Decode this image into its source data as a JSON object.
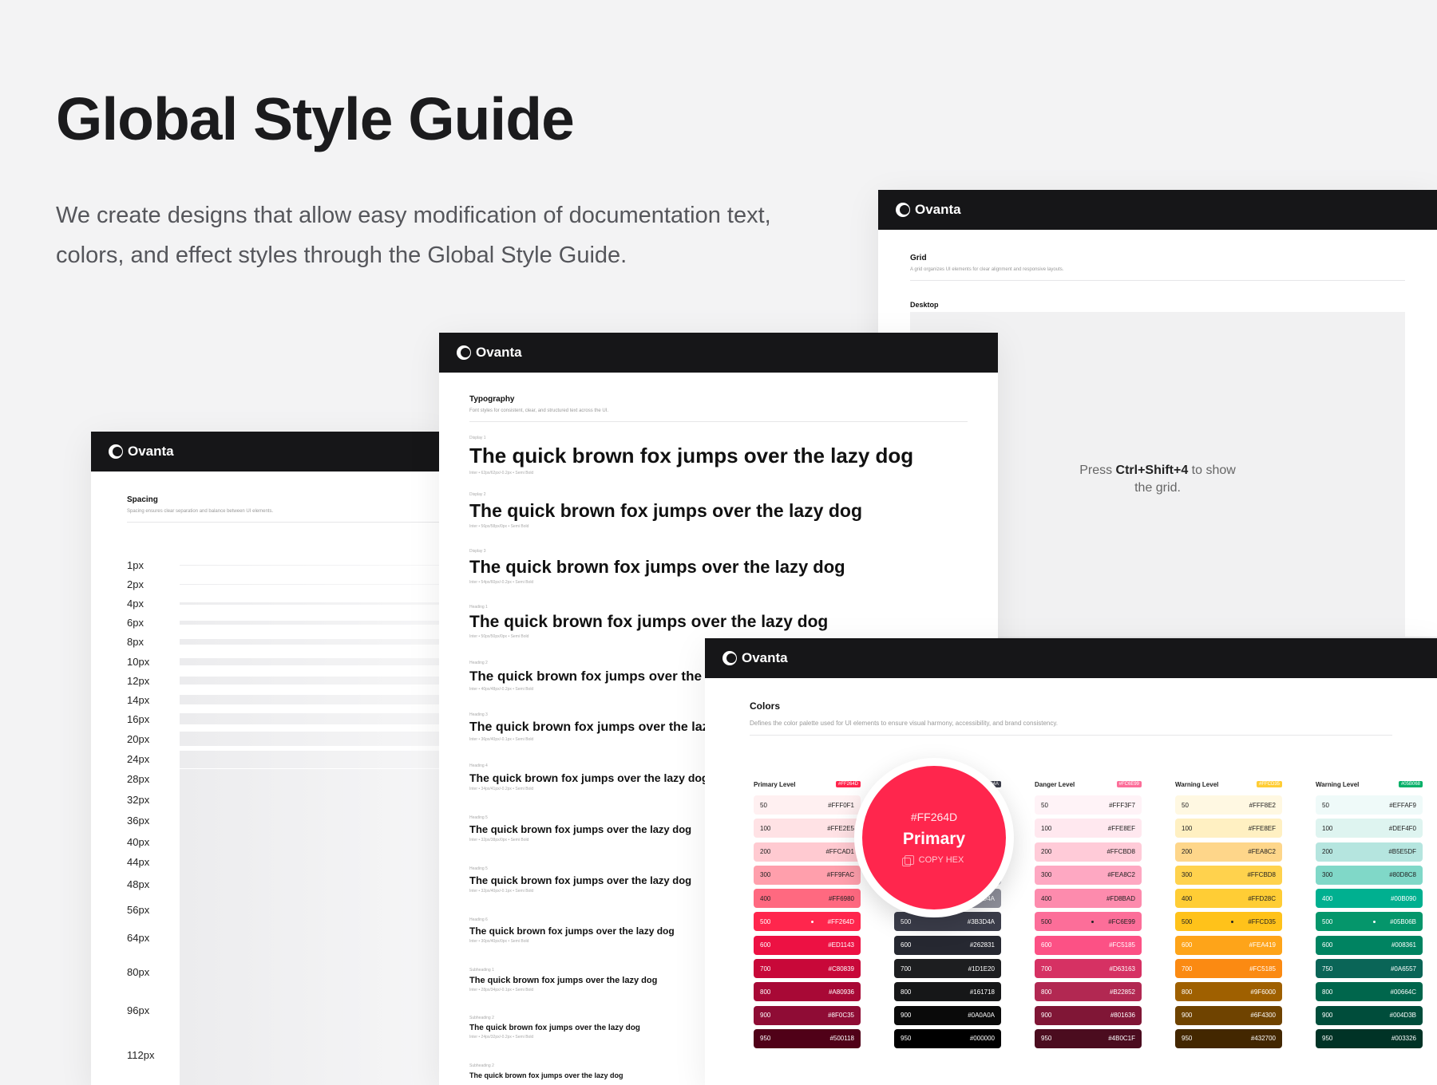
{
  "hero": {
    "title": "Global Style Guide",
    "subtitle": "We create designs that allow easy modification of documentation text, colors, and effect styles through the Global Style Guide."
  },
  "brand": "Ovanta",
  "grid_card": {
    "title": "Grid",
    "description": "A grid organizes UI elements for clear alignment and responsive layouts.",
    "desktop_label": "Desktop",
    "hint_prefix": "Press ",
    "hint_key": "Ctrl+Shift+4",
    "hint_suffix": " to show the grid."
  },
  "spacing_card": {
    "title": "Spacing",
    "description": "Spacing ensures clear separation and balance between UI elements.",
    "items": [
      {
        "label": "1px",
        "size": 1
      },
      {
        "label": "2px",
        "size": 2
      },
      {
        "label": "4px",
        "size": 4
      },
      {
        "label": "6px",
        "size": 6
      },
      {
        "label": "8px",
        "size": 8
      },
      {
        "label": "10px",
        "size": 10
      },
      {
        "label": "12px",
        "size": 12
      },
      {
        "label": "14px",
        "size": 14
      },
      {
        "label": "16px",
        "size": 16
      },
      {
        "label": "20px",
        "size": 20
      },
      {
        "label": "24px",
        "size": 24
      },
      {
        "label": "28px",
        "size": 28
      },
      {
        "label": "32px",
        "size": 32
      },
      {
        "label": "36px",
        "size": 36
      },
      {
        "label": "40px",
        "size": 40
      },
      {
        "label": "44px",
        "size": 44
      },
      {
        "label": "48px",
        "size": 48
      },
      {
        "label": "56px",
        "size": 56
      },
      {
        "label": "64px",
        "size": 64
      },
      {
        "label": "80px",
        "size": 80
      },
      {
        "label": "96px",
        "size": 96
      },
      {
        "label": "112px",
        "size": 112
      }
    ]
  },
  "typography_card": {
    "title": "Typography",
    "description": "Font styles for consistent, clear, and structured text across the UI.",
    "sample": "The quick brown fox jumps over the lazy dog",
    "styles": [
      {
        "caption": "Display 1",
        "meta": "Inter • 62px/62px/-0.2px • Semi Bold"
      },
      {
        "caption": "Display 2",
        "meta": "Inter • 56px/58px/0px • Semi Bold"
      },
      {
        "caption": "Display 3",
        "meta": "Inter • 54px/60px/-0.2px • Semi Bold"
      },
      {
        "caption": "Heading 1",
        "meta": "Inter • 50px/50px/0px • Semi Bold"
      },
      {
        "caption": "Heading 2",
        "meta": "Inter • 40px/48px/-0.2px • Semi Bold"
      },
      {
        "caption": "Heading 3",
        "meta": "Inter • 36px/40px/-0.1px • Semi Bold"
      },
      {
        "caption": "Heading 4",
        "meta": "Inter • 34px/41px/-0.2px • Semi Bold"
      },
      {
        "caption": "Heading 5",
        "meta": "Inter • 32px/38px/0px • Semi Bold"
      },
      {
        "caption": "Heading 5",
        "meta": "Inter • 32px/40px/-0.1px • Semi Bold"
      },
      {
        "caption": "Heading 6",
        "meta": "Inter • 30px/40px/0px • Semi Bold"
      },
      {
        "caption": "Subheading 1",
        "meta": "Inter • 28px/34px/-0.1px • Semi Bold"
      },
      {
        "caption": "Subheading 2",
        "meta": "Inter • 24px/32px/-0.2px • Semi Bold"
      },
      {
        "caption": "Subheading 2",
        "meta": ""
      }
    ]
  },
  "colors_card": {
    "title": "Colors",
    "description": "Defines the color palette used for UI elements to ensure visual harmony, accessibility, and brand consistency.",
    "groups": [
      {
        "name": "Primary Level",
        "tag": "#FF264D",
        "tag_color": "#ff264d",
        "swatches": [
          {
            "step": "50",
            "hex": "#FFF0F1",
            "bg": "#fff0f1",
            "fg": "#222"
          },
          {
            "step": "100",
            "hex": "#FFE2E5",
            "bg": "#ffe2e5",
            "fg": "#222"
          },
          {
            "step": "200",
            "hex": "#FFCAD1",
            "bg": "#ffcad1",
            "fg": "#222"
          },
          {
            "step": "300",
            "hex": "#FF9FAC",
            "bg": "#ff9fac",
            "fg": "#222"
          },
          {
            "step": "400",
            "hex": "#FF6980",
            "bg": "#ff6980",
            "fg": "#222"
          },
          {
            "step": "500",
            "hex": "#FF264D",
            "bg": "#ff264d",
            "fg": "#fff",
            "dot": true
          },
          {
            "step": "600",
            "hex": "#ED1143",
            "bg": "#ed1143",
            "fg": "#fff"
          },
          {
            "step": "700",
            "hex": "#C80839",
            "bg": "#c80839",
            "fg": "#fff"
          },
          {
            "step": "800",
            "hex": "#A80936",
            "bg": "#a80936",
            "fg": "#fff"
          },
          {
            "step": "900",
            "hex": "#8F0C35",
            "bg": "#8f0c35",
            "fg": "#fff"
          },
          {
            "step": "950",
            "hex": "#500118",
            "bg": "#500118",
            "fg": "#fff"
          }
        ]
      },
      {
        "name": "",
        "tag": "#3B3D4A",
        "tag_color": "#3b3d4a",
        "swatches": [
          {
            "step": "",
            "hex": "",
            "bg": "#f6f6f7",
            "fg": "#222"
          },
          {
            "step": "",
            "hex": "",
            "bg": "#ededef",
            "fg": "#222"
          },
          {
            "step": "",
            "hex": "",
            "bg": "#d8d8dc",
            "fg": "#222"
          },
          {
            "step": "",
            "hex": "",
            "bg": "#b7b8bf",
            "fg": "#222"
          },
          {
            "step": "",
            "hex": "#3B3D4A",
            "bg": "#8f909b",
            "fg": "#fff"
          },
          {
            "step": "500",
            "hex": "#3B3D4A",
            "bg": "#3b3d4a",
            "fg": "#fff"
          },
          {
            "step": "600",
            "hex": "#262831",
            "bg": "#262831",
            "fg": "#fff"
          },
          {
            "step": "700",
            "hex": "#1D1E20",
            "bg": "#1d1e20",
            "fg": "#fff"
          },
          {
            "step": "800",
            "hex": "#161718",
            "bg": "#161718",
            "fg": "#fff"
          },
          {
            "step": "900",
            "hex": "#0A0A0A",
            "bg": "#0a0a0a",
            "fg": "#fff"
          },
          {
            "step": "950",
            "hex": "#000000",
            "bg": "#000000",
            "fg": "#fff"
          }
        ]
      },
      {
        "name": "Danger Level",
        "tag": "#FC6E99",
        "tag_color": "#fc6e99",
        "swatches": [
          {
            "step": "50",
            "hex": "#FFF3F7",
            "bg": "#fff3f7",
            "fg": "#222"
          },
          {
            "step": "100",
            "hex": "#FFE8EF",
            "bg": "#ffe8ef",
            "fg": "#222"
          },
          {
            "step": "200",
            "hex": "#FFCBD8",
            "bg": "#ffcbd8",
            "fg": "#222"
          },
          {
            "step": "300",
            "hex": "#FEA8C2",
            "bg": "#fea8c2",
            "fg": "#222"
          },
          {
            "step": "400",
            "hex": "#FD8BAD",
            "bg": "#fd8bad",
            "fg": "#222"
          },
          {
            "step": "500",
            "hex": "#FC6E99",
            "bg": "#fc6e99",
            "fg": "#222",
            "dot": true
          },
          {
            "step": "600",
            "hex": "#FC5185",
            "bg": "#fc5185",
            "fg": "#fff"
          },
          {
            "step": "700",
            "hex": "#D63163",
            "bg": "#d63163",
            "fg": "#fff"
          },
          {
            "step": "800",
            "hex": "#B22852",
            "bg": "#b22852",
            "fg": "#fff"
          },
          {
            "step": "900",
            "hex": "#801636",
            "bg": "#801636",
            "fg": "#fff"
          },
          {
            "step": "950",
            "hex": "#4B0C1F",
            "bg": "#4b0c1f",
            "fg": "#fff"
          }
        ]
      },
      {
        "name": "Warning Level",
        "tag": "#FFCD35",
        "tag_color": "#ffcd35",
        "swatches": [
          {
            "step": "50",
            "hex": "#FFF8E2",
            "bg": "#fff8e2",
            "fg": "#222"
          },
          {
            "step": "100",
            "hex": "#FFE8EF",
            "bg": "#fff0c2",
            "fg": "#222"
          },
          {
            "step": "200",
            "hex": "#FEA8C2",
            "bg": "#fed68a",
            "fg": "#222"
          },
          {
            "step": "300",
            "hex": "#FFCBD8",
            "bg": "#ffd24d",
            "fg": "#222"
          },
          {
            "step": "400",
            "hex": "#FFD28C",
            "bg": "#ffcd35",
            "fg": "#222"
          },
          {
            "step": "500",
            "hex": "#FFCD35",
            "bg": "#ffc21a",
            "fg": "#222",
            "dot": true
          },
          {
            "step": "600",
            "hex": "#FEA419",
            "bg": "#fea419",
            "fg": "#fff"
          },
          {
            "step": "700",
            "hex": "#FC5185",
            "bg": "#fb8a12",
            "fg": "#fff"
          },
          {
            "step": "800",
            "hex": "#9F6000",
            "bg": "#9f6000",
            "fg": "#fff"
          },
          {
            "step": "900",
            "hex": "#6F4300",
            "bg": "#6f4300",
            "fg": "#fff"
          },
          {
            "step": "950",
            "hex": "#432700",
            "bg": "#432700",
            "fg": "#fff"
          }
        ]
      },
      {
        "name": "Warning Level",
        "tag": "#05B068",
        "tag_color": "#05b068",
        "swatches": [
          {
            "step": "50",
            "hex": "#EFFAF9",
            "bg": "#effaf9",
            "fg": "#222"
          },
          {
            "step": "100",
            "hex": "#DEF4F0",
            "bg": "#def4f0",
            "fg": "#222"
          },
          {
            "step": "200",
            "hex": "#B5E5DF",
            "bg": "#b5e5df",
            "fg": "#222"
          },
          {
            "step": "300",
            "hex": "#80D8C8",
            "bg": "#80d8c8",
            "fg": "#222"
          },
          {
            "step": "400",
            "hex": "#00B090",
            "bg": "#00b090",
            "fg": "#fff"
          },
          {
            "step": "500",
            "hex": "#05B06B",
            "bg": "#05966b",
            "fg": "#fff",
            "dot": true
          },
          {
            "step": "600",
            "hex": "#008361",
            "bg": "#008361",
            "fg": "#fff"
          },
          {
            "step": "750",
            "hex": "#0A6557",
            "bg": "#0a6557",
            "fg": "#fff"
          },
          {
            "step": "800",
            "hex": "#00664C",
            "bg": "#00664c",
            "fg": "#fff"
          },
          {
            "step": "900",
            "hex": "#004D3B",
            "bg": "#004d3b",
            "fg": "#fff"
          },
          {
            "step": "950",
            "hex": "#003326",
            "bg": "#003326",
            "fg": "#fff"
          }
        ]
      }
    ]
  },
  "primary_badge": {
    "hex": "#FF264D",
    "name": "Primary",
    "copy_label": "COPY HEX"
  }
}
